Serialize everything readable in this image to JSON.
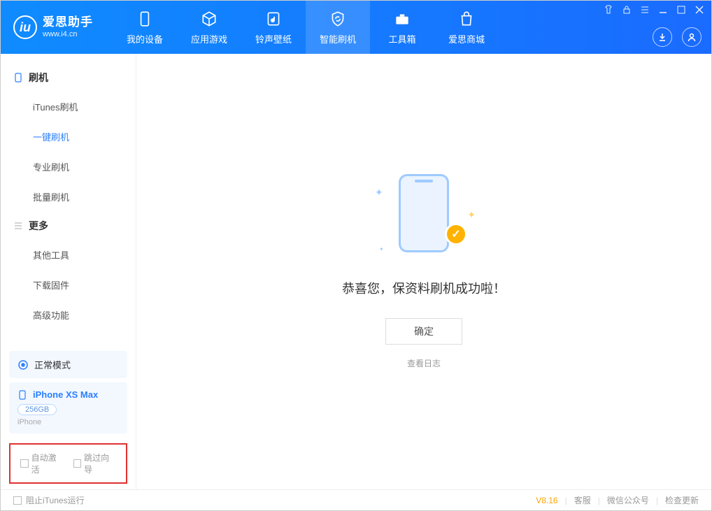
{
  "app": {
    "logo_letter": "iu",
    "title": "爱思助手",
    "subtitle": "www.i4.cn"
  },
  "tabs": [
    {
      "label": "我的设备"
    },
    {
      "label": "应用游戏"
    },
    {
      "label": "铃声壁纸"
    },
    {
      "label": "智能刷机"
    },
    {
      "label": "工具箱"
    },
    {
      "label": "爱思商城"
    }
  ],
  "sections": {
    "section1_title": "刷机",
    "section1_items": [
      {
        "label": "iTunes刷机"
      },
      {
        "label": "一键刷机"
      },
      {
        "label": "专业刷机"
      },
      {
        "label": "批量刷机"
      }
    ],
    "section2_title": "更多",
    "section2_items": [
      {
        "label": "其他工具"
      },
      {
        "label": "下载固件"
      },
      {
        "label": "高级功能"
      }
    ]
  },
  "device": {
    "mode": "正常模式",
    "name": "iPhone XS Max",
    "storage": "256GB",
    "type": "iPhone"
  },
  "checkboxes": {
    "auto_activate": "自动激活",
    "skip_guide": "跳过向导"
  },
  "main": {
    "success": "恭喜您，保资料刷机成功啦！",
    "ok": "确定",
    "view_log": "查看日志"
  },
  "footer": {
    "block_itunes": "阻止iTunes运行",
    "version": "V8.16",
    "link1": "客服",
    "link2": "微信公众号",
    "link3": "检查更新"
  }
}
